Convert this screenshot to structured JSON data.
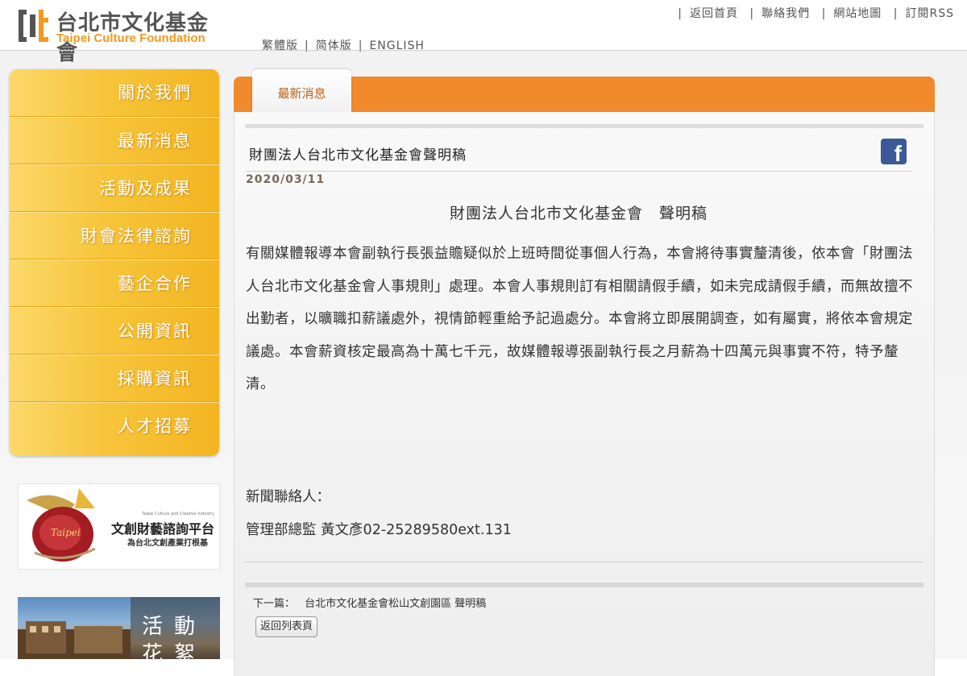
{
  "header": {
    "logo_zh": "台北市文化基金會",
    "logo_en": "Taipei Culture Foundation",
    "top_links": [
      "返回首頁",
      "聯絡我們",
      "網站地圖",
      "訂閱RSS"
    ],
    "lang_links": [
      "繁體版",
      "简体版",
      "ENGLISH"
    ]
  },
  "sidebar": {
    "items": [
      {
        "label": "關於我們"
      },
      {
        "label": "最新消息"
      },
      {
        "label": "活動及成果"
      },
      {
        "label": "財會法律諮詢"
      },
      {
        "label": "藝企合作"
      },
      {
        "label": "公開資訊"
      },
      {
        "label": "採購資訊"
      },
      {
        "label": "人才招募"
      }
    ],
    "banner1": {
      "title": "文創財藝諮詢平台",
      "subtitle": "為台北文創產業打根基",
      "en": "Taipei Culture and Creative Industry"
    },
    "banner2": {
      "text1": "活動",
      "text2": "花絮"
    }
  },
  "tab": {
    "label": "最新消息"
  },
  "article": {
    "title": "財團法人台北市文化基金會聲明稿",
    "date": "2020/03/11",
    "heading": "財團法人台北市文化基金會　聲明稿",
    "body": "有關媒體報導本會副執行長張益贍疑似於上班時間從事個人行為，本會將待事實釐清後，依本會「財團法人台北市文化基金會人事規則」處理。本會人事規則訂有相關請假手續，如未完成請假手續，而無故擅不出勤者，以曠職扣薪議處外，視情節輕重給予記過處分。本會將立即展開調查，如有屬實，將依本會規定議處。本會薪資核定最高為十萬七千元，故媒體報導張副執行長之月薪為十四萬元與事實不符，特予釐清。",
    "contact_label": "新聞聯絡人：",
    "contact_value": "管理部總監 黃文彥02-25289580ext.131"
  },
  "navigation": {
    "next_label": "下一篇：",
    "next_title": "台北市文化基金會松山文創園區 聲明稿",
    "back_button": "返回列表頁"
  },
  "icons": {
    "facebook": "facebook-icon"
  },
  "colors": {
    "accent_orange": "#f08a2c",
    "menu_yellow": "#f7c53b",
    "facebook_blue": "#3b5998",
    "logo_orange": "#f39a1e"
  }
}
